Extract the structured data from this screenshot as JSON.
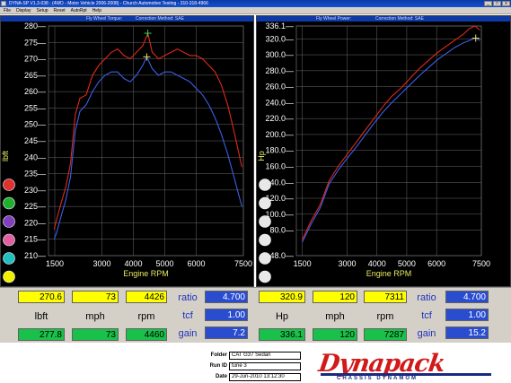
{
  "window": {
    "title": "DYNA-SP V1.3-038 : (4WD - Motor Vehicle 2006-2008) - Church Automotive Testing - 310-318-4966",
    "buttons": [
      "_",
      "□",
      "x"
    ]
  },
  "menu": [
    "File",
    "Display",
    "Setup",
    "Reset",
    "AutoRpt",
    "Help"
  ],
  "colors": {
    "run1": "#e02a1a",
    "run2": "#3a60e8",
    "grid": "#6a6a6a",
    "axis": "#ffffff"
  },
  "torque_panel": {
    "header_left": "Fly Wheel Torque:",
    "header_right": "Correction Method: SAE",
    "chart_data": {
      "type": "line",
      "xlabel": "Engine RPM",
      "ylabel": "lbft",
      "xlim": [
        1300,
        7500
      ],
      "ylim": [
        210,
        280
      ],
      "xticks": [
        "1500",
        "3000",
        "4000",
        "5000",
        "6000",
        "7500"
      ],
      "yticks": [
        "280",
        "275",
        "270",
        "265",
        "260",
        "255",
        "250",
        "245",
        "240",
        "235",
        "230",
        "225",
        "220",
        "215",
        "210"
      ],
      "grid": true,
      "run_buttons": [
        "#e03030",
        "#20b030",
        "#8040c0",
        "#e060a0",
        "#20c0c0",
        "#f0f000"
      ],
      "markers": [
        {
          "x": 4460,
          "y": 277.8,
          "color": "#30d060"
        },
        {
          "x": 4426,
          "y": 270.6,
          "color": "#e8e060"
        }
      ],
      "series": [
        {
          "color": "#e02a1a",
          "x": [
            1480,
            1560,
            1700,
            1850,
            2000,
            2150,
            2300,
            2500,
            2700,
            2900,
            3100,
            3300,
            3500,
            3700,
            3900,
            4100,
            4300,
            4460,
            4600,
            4800,
            5000,
            5200,
            5400,
            5600,
            5800,
            6000,
            6200,
            6400,
            6600,
            6800,
            7000,
            7200,
            7450
          ],
          "y": [
            218,
            221,
            226,
            231,
            238,
            253,
            258,
            259,
            265,
            268,
            270,
            272,
            273,
            271,
            270,
            272,
            274,
            277.8,
            272,
            270,
            271,
            272,
            273,
            272,
            271,
            271,
            270,
            268,
            266,
            262,
            256,
            248,
            237
          ]
        },
        {
          "color": "#3a60e8",
          "x": [
            1480,
            1560,
            1700,
            1850,
            2000,
            2150,
            2300,
            2500,
            2700,
            2900,
            3100,
            3300,
            3500,
            3700,
            3900,
            4100,
            4300,
            4426,
            4600,
            4800,
            5000,
            5200,
            5400,
            5600,
            5800,
            6000,
            6200,
            6400,
            6600,
            6800,
            7000,
            7200,
            7450
          ],
          "y": [
            215,
            217,
            222,
            227,
            234,
            248,
            254,
            256,
            260,
            263,
            265,
            266,
            266,
            264,
            263,
            265,
            268,
            270.6,
            267,
            265,
            266,
            266,
            265,
            264,
            263,
            261,
            259,
            256,
            252,
            247,
            241,
            234,
            225
          ]
        }
      ]
    }
  },
  "power_panel": {
    "header_left": "Fly Wheel Power:",
    "header_right": "Correction Method: SAE",
    "chart_data": {
      "type": "line",
      "xlabel": "Engine RPM",
      "ylabel": "Hp",
      "xlim": [
        1300,
        7500
      ],
      "ylim": [
        48,
        336.1
      ],
      "xticks": [
        "1500",
        "3000",
        "4000",
        "5000",
        "6000",
        "7500"
      ],
      "yticks": [
        "336.1",
        "320.0",
        "300.0",
        "280.0",
        "260.0",
        "240.0",
        "220.0",
        "200.0",
        "180.0",
        "160.0",
        "140.0",
        "120.0",
        "100.0",
        "80.0",
        "48.0"
      ],
      "grid": true,
      "run_buttons": [
        "#e8e8e8",
        "#e8e8e8",
        "#e8e8e8",
        "#e8e8e8",
        "#e8e8e8",
        "#e8e8e8"
      ],
      "markers": [
        {
          "x": 7311,
          "y": 320.9,
          "color": "#e8e060"
        }
      ],
      "series": [
        {
          "color": "#e02a1a",
          "x": [
            1500,
            1800,
            2100,
            2400,
            2700,
            3000,
            3300,
            3600,
            3900,
            4200,
            4500,
            4800,
            5100,
            5400,
            5700,
            6000,
            6300,
            6600,
            6900,
            7100,
            7287,
            7450
          ],
          "y": [
            68,
            92,
            112,
            142,
            160,
            175,
            190,
            205,
            220,
            235,
            248,
            258,
            270,
            282,
            292,
            302,
            310,
            318,
            326,
            333,
            336.1,
            331
          ]
        },
        {
          "color": "#3a60e8",
          "x": [
            1500,
            1800,
            2100,
            2400,
            2700,
            3000,
            3300,
            3600,
            3900,
            4200,
            4500,
            4800,
            5100,
            5400,
            5700,
            6000,
            6300,
            6600,
            6900,
            7100,
            7311,
            7450
          ],
          "y": [
            65,
            88,
            108,
            138,
            155,
            170,
            184,
            199,
            214,
            228,
            240,
            251,
            262,
            273,
            283,
            293,
            301,
            309,
            315,
            318,
            320.9,
            318
          ]
        }
      ]
    }
  },
  "readouts": {
    "torque": {
      "top": [
        "270.6",
        "73",
        "4426"
      ],
      "labels": [
        "lbft",
        "mph",
        "rpm"
      ],
      "bottom": [
        "277.8",
        "73",
        "4460"
      ],
      "side_labels": [
        "ratio",
        "tcf",
        "gain"
      ],
      "side_values": [
        "4.700",
        "1.00",
        "7.2"
      ]
    },
    "power": {
      "top": [
        "320.9",
        "120",
        "7311"
      ],
      "labels": [
        "Hp",
        "mph",
        "rpm"
      ],
      "bottom": [
        "336.1",
        "120",
        "7287"
      ],
      "side_labels": [
        "ratio",
        "tcf",
        "gain"
      ],
      "side_values": [
        "4.700",
        "1.00",
        "15.2"
      ]
    }
  },
  "info": {
    "folder_label": "Folder",
    "folder_value": "CAT G37 Sedan",
    "run_label": "Run ID",
    "run_value": "tune 3",
    "date_label": "Date",
    "date_value": "29-Jun-2010  13:12:30"
  },
  "logo": {
    "brand": "Dynapack",
    "sub": "CHASSIS   DYNAMOM"
  }
}
